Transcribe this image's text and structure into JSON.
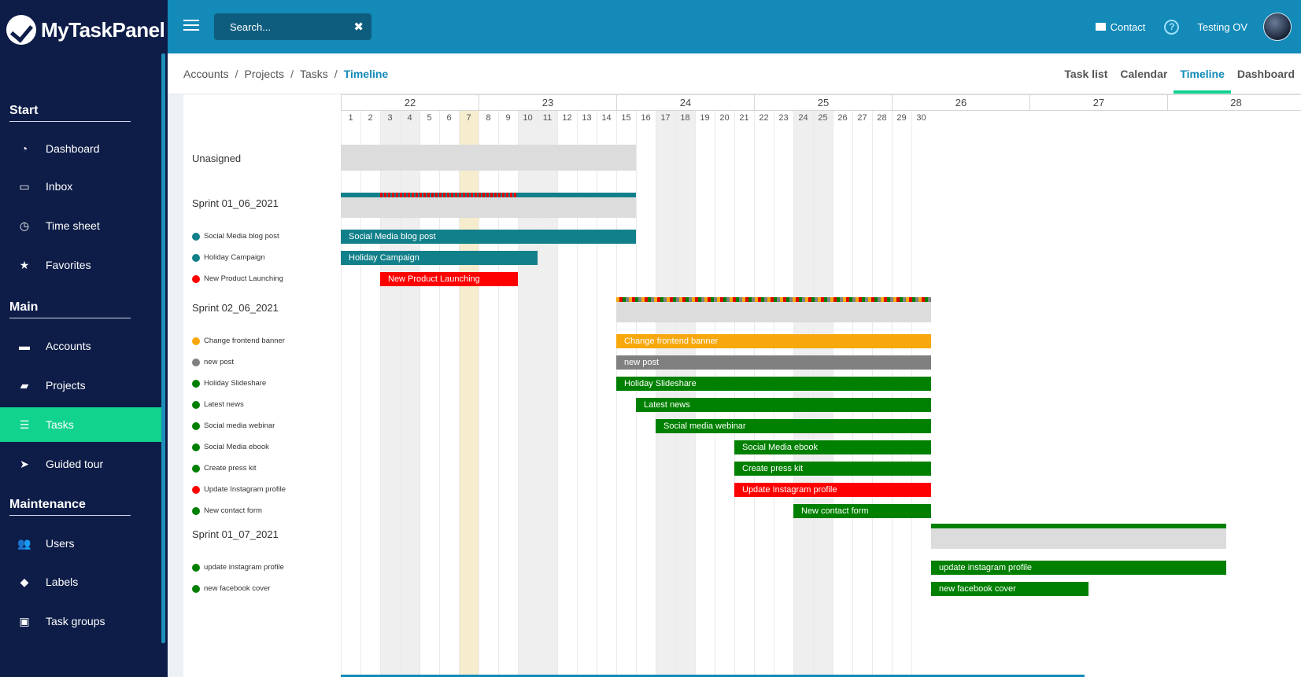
{
  "app": {
    "name": "MyTaskPanel"
  },
  "sidebar": {
    "sections": [
      {
        "title": "Start",
        "items": [
          {
            "label": "Dashboard",
            "icon": "gauge-icon"
          },
          {
            "label": "Inbox",
            "icon": "inbox-icon"
          },
          {
            "label": "Time sheet",
            "icon": "clock-icon"
          },
          {
            "label": "Favorites",
            "icon": "star-icon"
          }
        ]
      },
      {
        "title": "Main",
        "items": [
          {
            "label": "Accounts",
            "icon": "briefcase-icon"
          },
          {
            "label": "Projects",
            "icon": "folder-icon"
          },
          {
            "label": "Tasks",
            "icon": "tasks-icon",
            "active": true
          },
          {
            "label": "Guided tour",
            "icon": "paper-plane-icon"
          }
        ]
      },
      {
        "title": "Maintenance",
        "items": [
          {
            "label": "Users",
            "icon": "users-icon"
          },
          {
            "label": "Labels",
            "icon": "tags-icon"
          },
          {
            "label": "Task groups",
            "icon": "task-groups-icon"
          }
        ]
      }
    ]
  },
  "topbar": {
    "search_placeholder": "Search...",
    "contact_label": "Contact",
    "user_name": "Testing OV"
  },
  "breadcrumb": [
    "Accounts",
    "Projects",
    "Tasks",
    "Timeline"
  ],
  "view_tabs": [
    "Task list",
    "Calendar",
    "Timeline",
    "Dashboard"
  ],
  "active_view": "Timeline",
  "timeline": {
    "weeks": [
      "22",
      "23",
      "24",
      "25",
      "26",
      "27",
      "28"
    ],
    "days": [
      "1",
      "2",
      "3",
      "4",
      "5",
      "6",
      "7",
      "8",
      "9",
      "10",
      "11",
      "12",
      "13",
      "14",
      "15",
      "16",
      "17",
      "18",
      "19",
      "20",
      "21",
      "22",
      "23",
      "24",
      "25",
      "26",
      "27",
      "28",
      "29",
      "30"
    ],
    "weekend_days": [
      3,
      4,
      10,
      11,
      17,
      18,
      24,
      25
    ],
    "today": 7,
    "groups": [
      {
        "label": "Unasigned",
        "start": 1,
        "end": 16,
        "top_colors": [],
        "tasks": []
      },
      {
        "label": "Sprint 01_06_2021",
        "start": 1,
        "end": 16,
        "top_colors": [
          "#12808a",
          "#e00000"
        ],
        "tasks": [
          {
            "label": "Social Media blog post",
            "color": "#12808a",
            "start": 1,
            "end": 16
          },
          {
            "label": "Holiday Campaign",
            "color": "#12808a",
            "start": 1,
            "end": 11
          },
          {
            "label": "New Product Launching",
            "color": "#ff0000",
            "start": 3,
            "end": 10
          }
        ]
      },
      {
        "label": "Sprint 02_06_2021",
        "start": 15,
        "end": 31,
        "top_colors": [
          "#f6a80b",
          "#e00000",
          "#008000",
          "#808080"
        ],
        "tasks": [
          {
            "label": "Change frontend banner",
            "color": "#f7a80c",
            "start": 15,
            "end": 31
          },
          {
            "label": "new post",
            "color": "#808080",
            "start": 15,
            "end": 31
          },
          {
            "label": "Holiday Slideshare",
            "color": "#008000",
            "start": 15,
            "end": 31
          },
          {
            "label": "Latest news",
            "color": "#008000",
            "start": 16,
            "end": 31
          },
          {
            "label": "Social media webinar",
            "color": "#008000",
            "start": 17,
            "end": 31
          },
          {
            "label": "Social Media ebook",
            "color": "#008000",
            "start": 21,
            "end": 31
          },
          {
            "label": "Create press kit",
            "color": "#008000",
            "start": 21,
            "end": 31
          },
          {
            "label": "Update Instagram profile",
            "color": "#ff0000",
            "start": 21,
            "end": 31
          },
          {
            "label": "New contact form",
            "color": "#008000",
            "start": 24,
            "end": 31
          }
        ]
      },
      {
        "label": "Sprint 01_07_2021",
        "start": 31,
        "end": 46,
        "top_colors": [
          "#008000"
        ],
        "tasks": [
          {
            "label": "update instagram profile",
            "color": "#008000",
            "start": 31,
            "end": 46
          },
          {
            "label": "new facebook cover",
            "color": "#008000",
            "start": 31,
            "end": 39
          }
        ]
      }
    ]
  }
}
